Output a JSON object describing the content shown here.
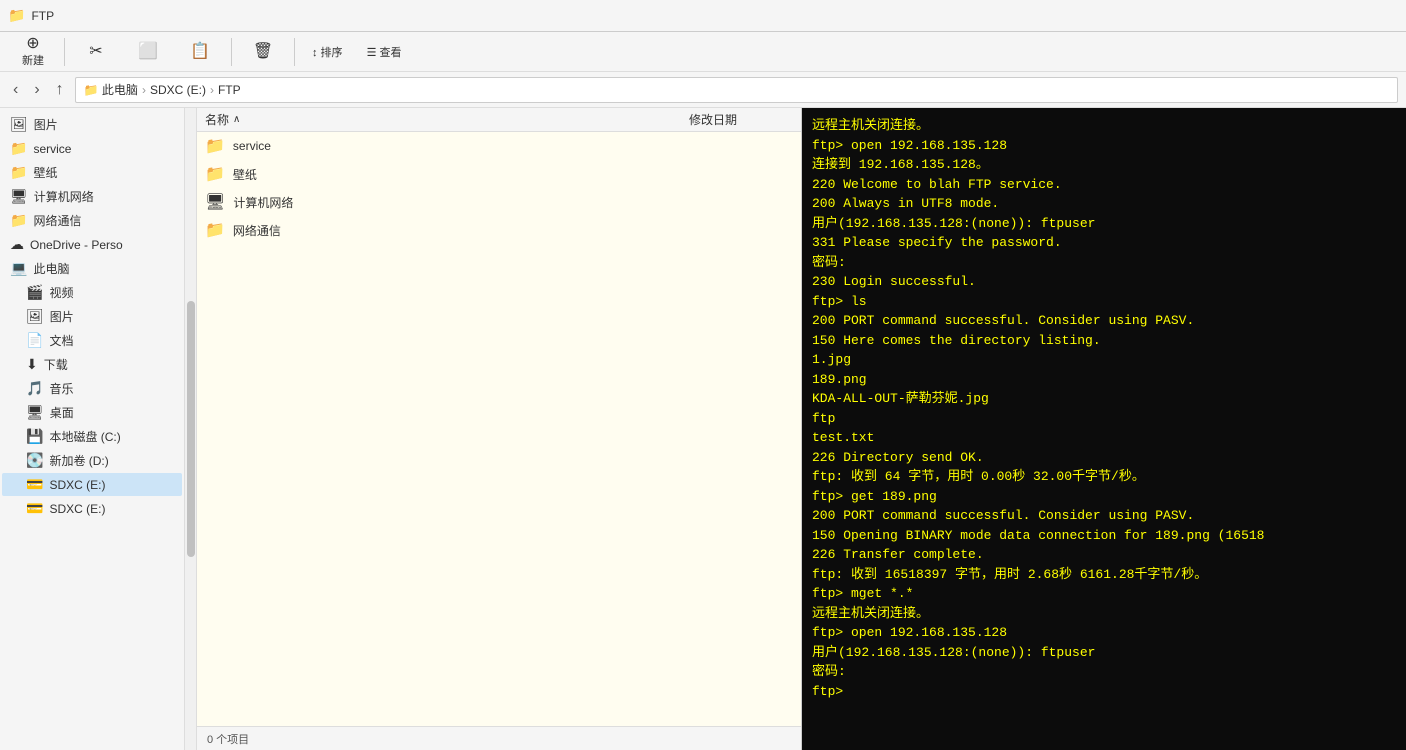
{
  "titleBar": {
    "title": "FTP",
    "icon": "📁"
  },
  "toolbar": {
    "newBtn": "新建",
    "cutBtn": "✂",
    "copyBtn": "⬜",
    "pasteBtn": "📋",
    "deleteBtn": "🗑",
    "sortBtn": "↕ 排序",
    "viewBtn": "☰ 查看"
  },
  "addressBar": {
    "backDisabled": false,
    "forwardDisabled": true,
    "upDisabled": false,
    "path": [
      "此电脑",
      "SDXC (E:)",
      "FTP"
    ]
  },
  "sidebar": {
    "items": [
      {
        "id": "pictures-pinned",
        "icon": "🖼",
        "label": "图片",
        "pinned": true,
        "indent": 0
      },
      {
        "id": "service",
        "icon": "📁",
        "label": "service",
        "pinned": false,
        "indent": 0
      },
      {
        "id": "wallpaper",
        "icon": "📁",
        "label": "壁纸",
        "pinned": false,
        "indent": 0
      },
      {
        "id": "network",
        "icon": "🖥",
        "label": "计算机网络",
        "pinned": false,
        "indent": 0
      },
      {
        "id": "netcomm",
        "icon": "📁",
        "label": "网络通信",
        "pinned": false,
        "indent": 0
      },
      {
        "id": "onedrive",
        "icon": "☁",
        "label": "OneDrive - Perso",
        "pinned": false,
        "indent": 0
      },
      {
        "id": "thispc",
        "icon": "💻",
        "label": "此电脑",
        "pinned": false,
        "indent": 0,
        "expanded": true
      },
      {
        "id": "video",
        "icon": "🎬",
        "label": "视频",
        "pinned": false,
        "indent": 1
      },
      {
        "id": "pictures2",
        "icon": "🖼",
        "label": "图片",
        "pinned": false,
        "indent": 1
      },
      {
        "id": "docs",
        "icon": "📄",
        "label": "文档",
        "pinned": false,
        "indent": 1
      },
      {
        "id": "downloads",
        "icon": "⬇",
        "label": "下载",
        "pinned": false,
        "indent": 1
      },
      {
        "id": "music",
        "icon": "🎵",
        "label": "音乐",
        "pinned": false,
        "indent": 1
      },
      {
        "id": "desktop",
        "icon": "🖥",
        "label": "桌面",
        "pinned": false,
        "indent": 1
      },
      {
        "id": "local-c",
        "icon": "💾",
        "label": "本地磁盘 (C:)",
        "pinned": false,
        "indent": 1
      },
      {
        "id": "drive-d",
        "icon": "💽",
        "label": "新加卷 (D:)",
        "pinned": false,
        "indent": 1
      },
      {
        "id": "sdxc-e",
        "icon": "💳",
        "label": "SDXC (E:)",
        "pinned": false,
        "indent": 1,
        "selected": true
      },
      {
        "id": "sdxc-e2",
        "icon": "💳",
        "label": "SDXC (E:)",
        "pinned": false,
        "indent": 1
      }
    ]
  },
  "fileList": {
    "colName": "名称",
    "colDate": "修改日期",
    "sortArrow": "∧",
    "items": [
      {
        "id": "service-folder",
        "icon": "📁",
        "name": "service",
        "date": ""
      },
      {
        "id": "wallpaper-folder",
        "icon": "📁",
        "name": "壁纸",
        "date": ""
      },
      {
        "id": "netcomp-folder",
        "icon": "🖥",
        "name": "计算机网络",
        "date": ""
      },
      {
        "id": "netcomm-folder",
        "icon": "📁",
        "name": "网络通信",
        "date": ""
      }
    ]
  },
  "statusBar": {
    "text": "0 个项目"
  },
  "terminal": {
    "lines": [
      "远程主机关闭连接。",
      "ftp> open 192.168.135.128",
      "连接到 192.168.135.128。",
      "220 Welcome to blah FTP service.",
      "200 Always in UTF8 mode.",
      "用户(192.168.135.128:(none)): ftpuser",
      "331 Please specify the password.",
      "密码:",
      "230 Login successful.",
      "ftp> ls",
      "200 PORT command successful. Consider using PASV.",
      "150 Here comes the directory listing.",
      "1.jpg",
      "189.png",
      "KDA-ALL-OUT-萨勒芬妮.jpg",
      "ftp",
      "test.txt",
      "226 Directory send OK.",
      "ftp: 收到 64 字节，用时 0.00秒 32.00千字节/秒。",
      "ftp> get 189.png",
      "200 PORT command successful. Consider using PASV.",
      "150 Opening BINARY mode data connection for 189.png (16518",
      "226 Transfer complete.",
      "ftp: 收到 16518397 字节，用时 2.68秒 6161.28千字节/秒。",
      "ftp> mget *.*",
      "远程主机关闭连接。",
      "ftp> open 192.168.135.128",
      "用户(192.168.135.128:(none)): ftpuser",
      "密码:",
      "ftp> "
    ]
  }
}
